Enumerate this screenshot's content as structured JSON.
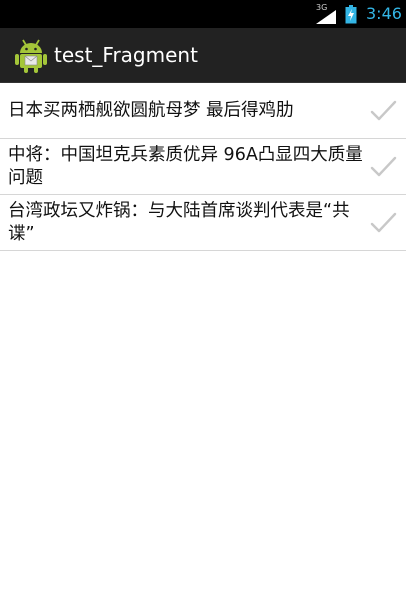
{
  "status_bar": {
    "network_type": "3G",
    "time": "3:46",
    "colors": {
      "time": "#33b5e5",
      "background": "#000000"
    }
  },
  "action_bar": {
    "title": "test_Fragment",
    "icon": "android-robot-icon",
    "colors": {
      "background": "#222222",
      "icon": "#a4c639"
    }
  },
  "news_list": {
    "items": [
      {
        "title": "日本买两栖舰欲圆航母梦 最后得鸡肋",
        "checked": false
      },
      {
        "title": "中将：中国坦克兵素质优异 96A凸显四大质量问题",
        "checked": false
      },
      {
        "title": "台湾政坛又炸锅：与大陆首席谈判代表是“共谍”",
        "checked": false
      }
    ],
    "check_icon": "checkmark-icon",
    "colors": {
      "check": "#c8c8c8",
      "divider": "#d6d6d6"
    }
  }
}
